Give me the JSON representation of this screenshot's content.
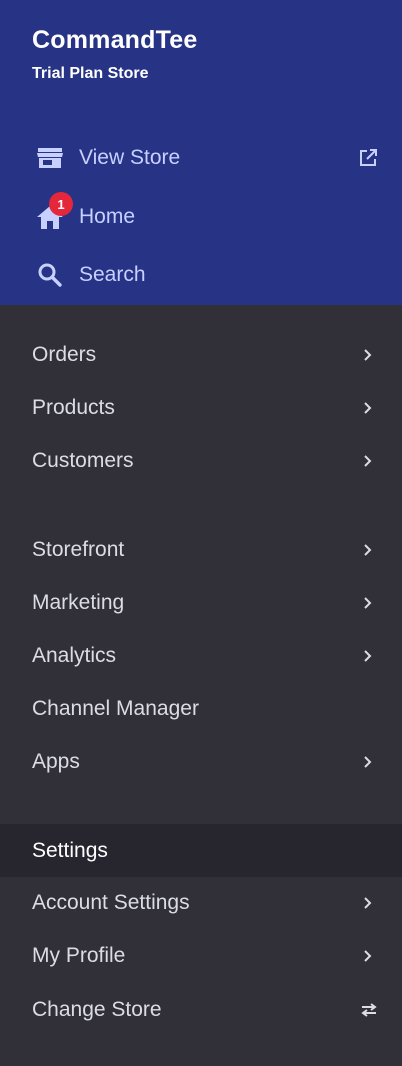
{
  "store": {
    "name": "CommandTee",
    "plan": "Trial Plan Store"
  },
  "quick_links": [
    {
      "label": "View Store",
      "icon": "storefront-icon"
    },
    {
      "label": "Home",
      "icon": "home-icon",
      "badge": "1"
    },
    {
      "label": "Search",
      "icon": "search-icon"
    }
  ],
  "nav_group_1": [
    {
      "label": "Orders",
      "icon": "chevron-right-icon"
    },
    {
      "label": "Products",
      "icon": "chevron-right-icon"
    },
    {
      "label": "Customers",
      "icon": "chevron-right-icon"
    }
  ],
  "nav_group_2": [
    {
      "label": "Storefront",
      "icon": "chevron-right-icon"
    },
    {
      "label": "Marketing",
      "icon": "chevron-right-icon"
    },
    {
      "label": "Analytics",
      "icon": "chevron-right-icon"
    },
    {
      "label": "Channel Manager"
    },
    {
      "label": "Apps",
      "icon": "chevron-right-icon"
    }
  ],
  "settings": {
    "heading": "Settings",
    "items": [
      {
        "label": "Account Settings",
        "icon": "chevron-right-icon"
      },
      {
        "label": "My Profile",
        "icon": "chevron-right-icon"
      },
      {
        "label": "Change Store",
        "icon": "swap-icon"
      }
    ]
  },
  "colors": {
    "header_bg": "#273485",
    "nav_bg": "#313039",
    "settings_header_bg": "#27262f",
    "link_text": "#c7d0ff",
    "badge": "#e5273c"
  }
}
